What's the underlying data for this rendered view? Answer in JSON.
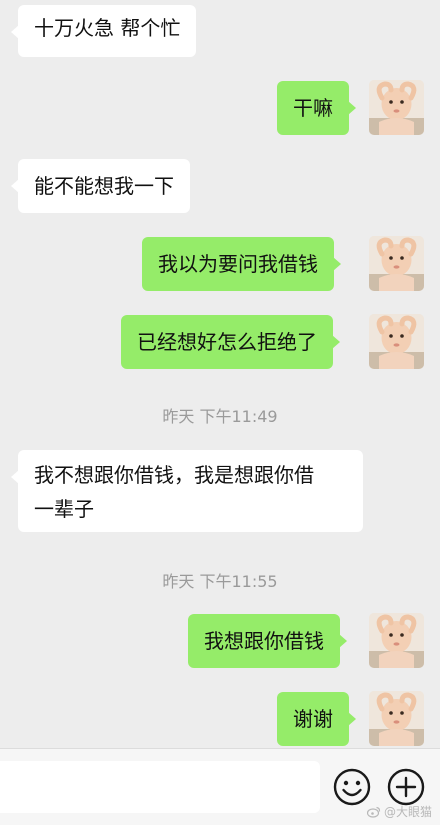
{
  "messages": [
    {
      "side": "in",
      "text": "十万火急 帮个忙"
    },
    {
      "side": "out",
      "text": "干嘛"
    },
    {
      "side": "in",
      "text": "能不能想我一下"
    },
    {
      "side": "out",
      "text": "我以为要问我借钱"
    },
    {
      "side": "out",
      "text": "已经想好怎么拒绝了"
    },
    {
      "side": "in",
      "lines": [
        "我不想跟你借钱，我是想跟你借",
        "一辈子"
      ]
    },
    {
      "side": "out",
      "text": "我想跟你借钱"
    },
    {
      "side": "out",
      "text": "谢谢"
    }
  ],
  "timestamps": [
    "昨天 下午11:49",
    "昨天 下午11:55"
  ],
  "input": {
    "icons": [
      "emoji-icon",
      "plus-icon"
    ]
  },
  "watermark": {
    "icon": "weibo-icon",
    "text": "@大眼猫"
  },
  "colors": {
    "background": "#ededed",
    "incoming_bubble": "#ffffff",
    "outgoing_bubble": "#95ec69"
  }
}
